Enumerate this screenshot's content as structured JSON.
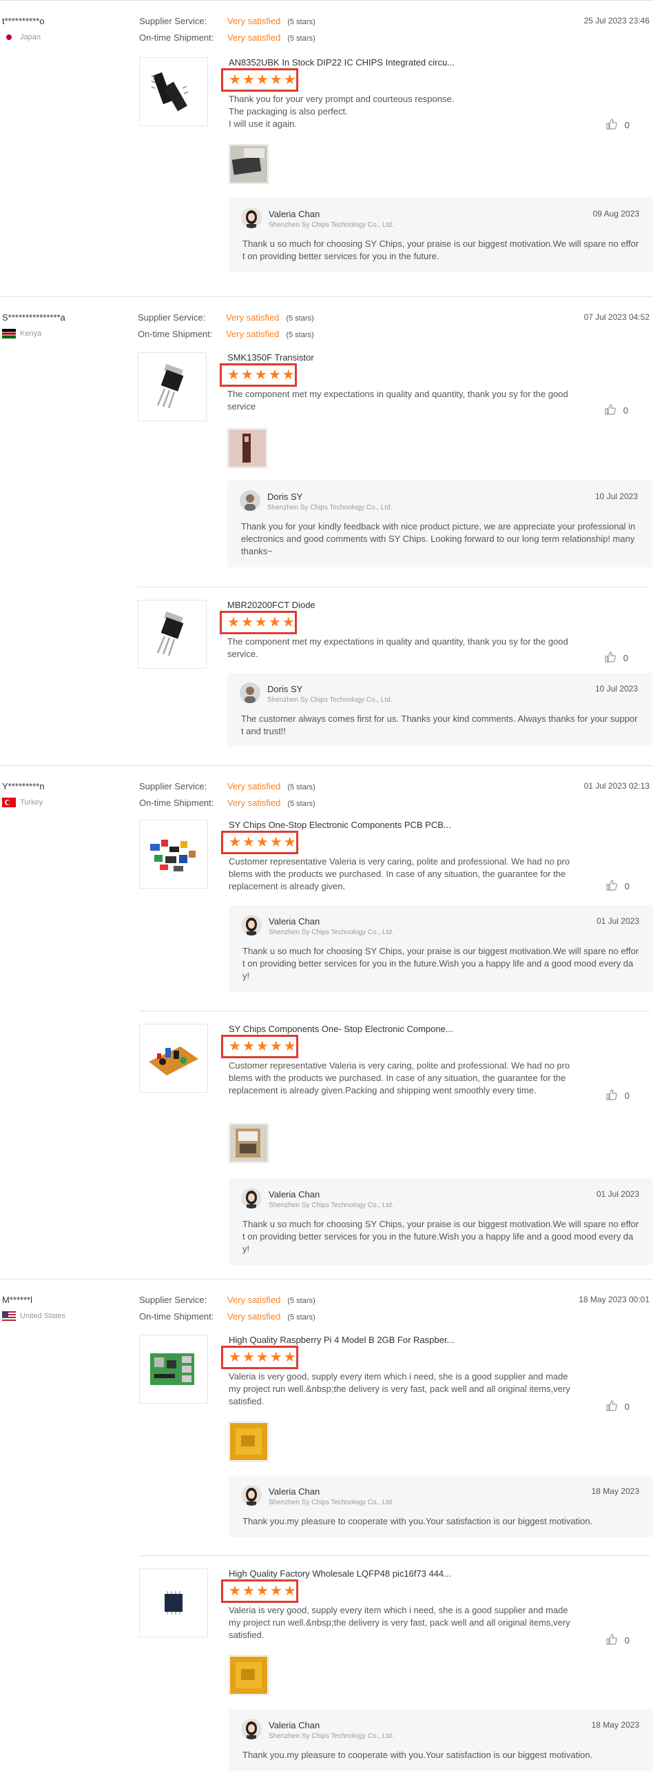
{
  "reviews": [
    {
      "buyer": "t**********o",
      "country": "Japan",
      "supplier_service_label": "Supplier Service:",
      "supplier_service_value": "Very satisfied",
      "supplier_service_stars": "(5 stars)",
      "shipment_label": "On-time Shipment:",
      "shipment_value": "Very satisfied",
      "shipment_stars": "(5 stars)",
      "date": "25 Jul 2023 23:46",
      "items": [
        {
          "title": "AN8352UBK In Stock DIP22 IC CHIPS Integrated circu...",
          "text": "Thank you for your very prompt and courteous response.\nThe packaging is also perfect.\nI will use it again.",
          "helpful": "0",
          "reply": {
            "name": "Valeria Chan",
            "company": "Shenzhen Sy Chips Technology Co., Ltd.",
            "date": "09 Aug 2023",
            "text": "Thank u so much for choosing SY Chips, your praise is our biggest motivation.We will spare no effort on providing better services for you in the future."
          }
        }
      ]
    },
    {
      "buyer": "S***************a",
      "country": "Kenya",
      "supplier_service_label": "Supplier Service:",
      "supplier_service_value": "Very satisfied",
      "supplier_service_stars": "(5 stars)",
      "shipment_label": "On-time Shipment:",
      "shipment_value": "Very satisfied",
      "shipment_stars": "(5 stars)",
      "date": "07 Jul 2023 04:52",
      "items": [
        {
          "title": "SMK1350F Transistor",
          "text": "The component met my expectations in quality and quantity, thank you sy for the good service",
          "helpful": "0",
          "reply": {
            "name": "Doris SY",
            "company": "Shenzhen Sy Chips Technology Co., Ltd.",
            "date": "10 Jul 2023",
            "text": "Thank you for your kindly feedback with nice product picture, we are appreciate your professional in electronics and good comments with SY Chips. Looking forward to our long term relationship! many thanks~"
          }
        },
        {
          "title": "MBR20200FCT Diode",
          "text": "The component met my expectations in quality and quantity, thank you sy for the good service.",
          "helpful": "0",
          "reply": {
            "name": "Doris SY",
            "company": "Shenzhen Sy Chips Technology Co., Ltd.",
            "date": "10 Jul 2023",
            "text": "The customer always comes first for us. Thanks your kind comments. Always thanks for your support and trust!!"
          }
        }
      ]
    },
    {
      "buyer": "Y*********n",
      "country": "Turkey",
      "supplier_service_label": "Supplier Service:",
      "supplier_service_value": "Very satisfied",
      "supplier_service_stars": "(5 stars)",
      "shipment_label": "On-time Shipment:",
      "shipment_value": "Very satisfied",
      "shipment_stars": "(5 stars)",
      "date": "01 Jul 2023 02:13",
      "items": [
        {
          "title": "SY Chips One-Stop Electronic Components PCB PCB...",
          "text": "Customer representative Valeria is very caring, polite and professional. We had no problems with the products we purchased. In case of any situation, the guarantee for the replacement is already given.",
          "helpful": "0",
          "reply": {
            "name": "Valeria Chan",
            "company": "Shenzhen Sy Chips Technology Co., Ltd.",
            "date": "01 Jul 2023",
            "text": "Thank u so much for choosing SY Chips, your praise is our biggest motivation.We will spare no effort on providing better services for you in the future.Wish you a happy life and a good mood every day!"
          }
        },
        {
          "title": "SY Chips Components One- Stop Electronic Compone...",
          "text": "Customer representative Valeria is very caring, polite and professional. We had no problems with the products we purchased. In case of any situation, the guarantee for the replacement is already given.Packing and shipping went smoothly every time.",
          "helpful": "0",
          "reply": {
            "name": "Valeria Chan",
            "company": "Shenzhen Sy Chips Technology Co., Ltd.",
            "date": "01 Jul 2023",
            "text": "Thank u so much for choosing SY Chips, your praise is our biggest motivation.We will spare no effort on providing better services for you in the future.Wish you a happy life and a good mood every day!"
          }
        }
      ]
    },
    {
      "buyer": "M******l",
      "country": "United States",
      "supplier_service_label": "Supplier Service:",
      "supplier_service_value": "Very satisfied",
      "supplier_service_stars": "(5 stars)",
      "shipment_label": "On-time Shipment:",
      "shipment_value": "Very satisfied",
      "shipment_stars": "(5 stars)",
      "date": "18 May 2023 00:01",
      "items": [
        {
          "title": "High Quality Raspberry Pi 4 Model B 2GB For Raspber...",
          "text": "Valeria is very good, supply every item which i need, she is a good supplier and made my project run well.&nbsp;the delivery is very fast, pack well and all original items,very satisfied.",
          "helpful": "0",
          "reply": {
            "name": "Valeria Chan",
            "company": "Shenzhen Sy Chips Technology Co., Ltd.",
            "date": "18 May 2023",
            "text": "Thank you.my pleasure to cooperate with you.Your satisfaction is our biggest motivation."
          }
        },
        {
          "title": "High Quality Factory Wholesale LQFP48 pic16f73 444...",
          "text": "Valeria is very good, supply every item which i need, she is a good supplier and made my project run well.&nbsp;the delivery is very fast, pack well and all original items,very satisfied.",
          "helpful": "0",
          "reply": {
            "name": "Valeria Chan",
            "company": "Shenzhen Sy Chips Technology Co., Ltd.",
            "date": "18 May 2023",
            "text": "Thank you.my pleasure to cooperate with you.Your satisfaction is our biggest motivation."
          }
        }
      ]
    }
  ],
  "star_glyph": "★",
  "colors": {
    "accent": "#ff7e1b",
    "highlight_box": "#e03a2f"
  }
}
